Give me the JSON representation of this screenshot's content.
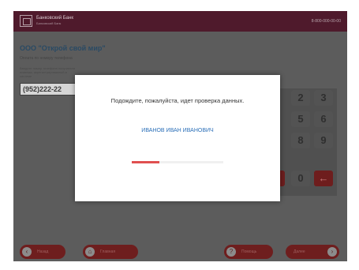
{
  "header": {
    "bank_name": "Банковский Банк",
    "bank_subtitle": "Банковский Банк",
    "support_text": "8-800-000-00-00"
  },
  "form": {
    "org_title": "ООО \"Открой свой мир\"",
    "subtitle": "Оплата по номеру телефона",
    "instruction": "Введите номер телефона получателя платежа, зарегистрированный в системе",
    "phone_value": "(952)222-22"
  },
  "keypad": {
    "keys": [
      "2",
      "3",
      "5",
      "6",
      "8",
      "9",
      "0",
      "←"
    ]
  },
  "modal": {
    "message": "Подождите, пожалуйста, идет проверка данных.",
    "name": "ИВАНОВ ИВАН ИВАНОВИЧ",
    "progress": 0.3
  },
  "bottom_nav": {
    "back_label": "Назад",
    "home_label": "Главная",
    "help_label": "Помощь",
    "next_label": "Далее"
  },
  "colors": {
    "accent": "#6e1e1e",
    "header_bg": "#4f1a2c",
    "name_blue": "#2b6fb8",
    "progress_red": "#e05050"
  }
}
